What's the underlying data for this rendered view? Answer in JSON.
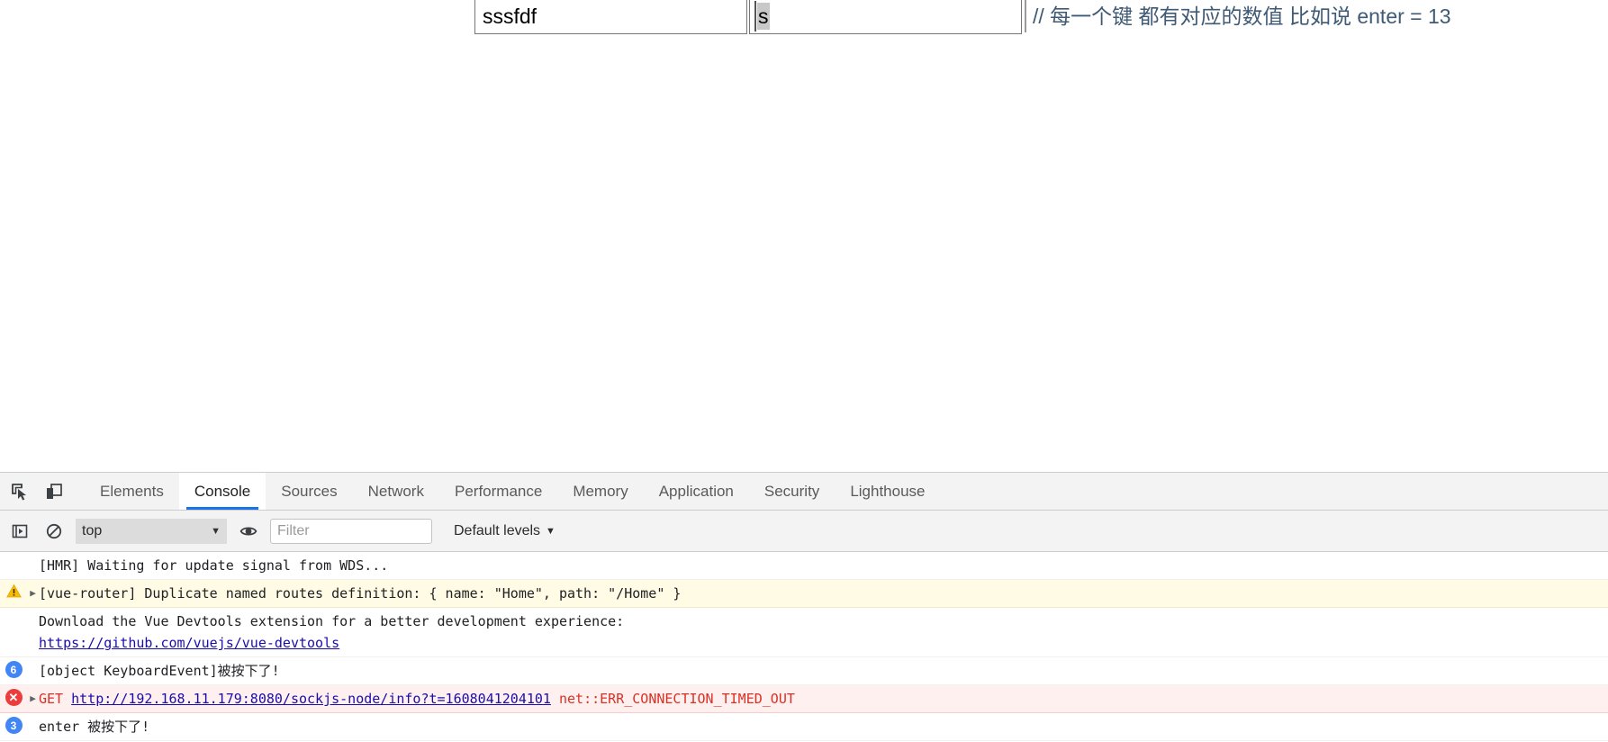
{
  "page": {
    "inputs": [
      {
        "name": "input-one",
        "value": "sssfdf",
        "placeholder": ""
      },
      {
        "name": "input-two",
        "value": "s",
        "placeholder": "",
        "selected_text": "s"
      }
    ],
    "comment": "// 每一个键 都有对应的数值 比如说 enter = 13",
    "comment_color": "#3f5a74"
  },
  "devtools": {
    "icons": {
      "inspect": "inspect-element-icon",
      "device": "device-toolbar-icon",
      "execute": "execute-snippet-icon",
      "clear": "clear-console-icon",
      "eye": "live-expression-eye-icon"
    },
    "tabs": [
      {
        "label": "Elements",
        "active": false
      },
      {
        "label": "Console",
        "active": true
      },
      {
        "label": "Sources",
        "active": false
      },
      {
        "label": "Network",
        "active": false
      },
      {
        "label": "Performance",
        "active": false
      },
      {
        "label": "Memory",
        "active": false
      },
      {
        "label": "Application",
        "active": false
      },
      {
        "label": "Security",
        "active": false
      },
      {
        "label": "Lighthouse",
        "active": false
      }
    ],
    "active_tab_accent": "#1a73e8",
    "filter_bar": {
      "context_value": "top",
      "context_arrow": "▼",
      "filter_placeholder": "Filter",
      "filter_value": "",
      "levels_label": "Default levels",
      "levels_arrow": "▼"
    },
    "console_messages": [
      {
        "level": "info",
        "badge": null,
        "disclosure": false,
        "segments": [
          {
            "type": "plain",
            "text": "[HMR] Waiting for update signal from WDS..."
          }
        ]
      },
      {
        "level": "warning",
        "badge": null,
        "disclosure": true,
        "segments": [
          {
            "type": "plain",
            "text": "[vue-router] Duplicate named routes definition: { name: \"Home\", path: \"/Home\" }"
          }
        ]
      },
      {
        "level": "info",
        "badge": null,
        "disclosure": false,
        "segments": [
          {
            "type": "plain",
            "text": "Download the Vue Devtools extension for a better development experience:\n"
          },
          {
            "type": "link",
            "text": "https://github.com/vuejs/vue-devtools"
          }
        ]
      },
      {
        "level": "info",
        "badge": "6",
        "disclosure": false,
        "segments": [
          {
            "type": "plain",
            "text": "[object KeyboardEvent]被按下了!"
          }
        ]
      },
      {
        "level": "error",
        "badge": "error",
        "disclosure": true,
        "segments": [
          {
            "type": "err",
            "text": "GET "
          },
          {
            "type": "errlink",
            "text": "http://192.168.11.179:8080/sockjs-node/info?t=1608041204101"
          },
          {
            "type": "err",
            "text": " net::ERR_CONNECTION_TIMED_OUT"
          }
        ]
      },
      {
        "level": "info",
        "badge": "3",
        "disclosure": false,
        "segments": [
          {
            "type": "plain",
            "text": "enter 被按下了!"
          }
        ]
      }
    ]
  }
}
